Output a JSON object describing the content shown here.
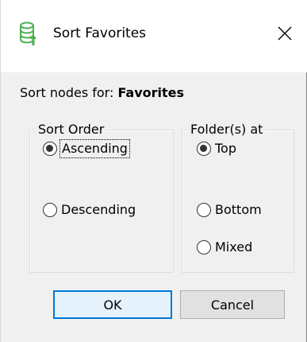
{
  "window": {
    "title": "Sort Favorites",
    "close_glyph": "✕",
    "icon": "sort-favorites-icon"
  },
  "prompt": {
    "prefix": "Sort nodes for: ",
    "target": "Favorites"
  },
  "sort_order": {
    "label": "Sort Order",
    "options": [
      {
        "label": "Ascending",
        "checked": true
      },
      {
        "label": "Descending",
        "checked": false
      }
    ]
  },
  "folders_at": {
    "label": "Folder(s) at",
    "options": [
      {
        "label": "Top",
        "checked": true
      },
      {
        "label": "Bottom",
        "checked": false
      },
      {
        "label": "Mixed",
        "checked": false
      }
    ]
  },
  "buttons": {
    "ok": "OK",
    "cancel": "Cancel"
  },
  "colors": {
    "accent": "#0078d7",
    "icon_green": "#4caf50"
  }
}
